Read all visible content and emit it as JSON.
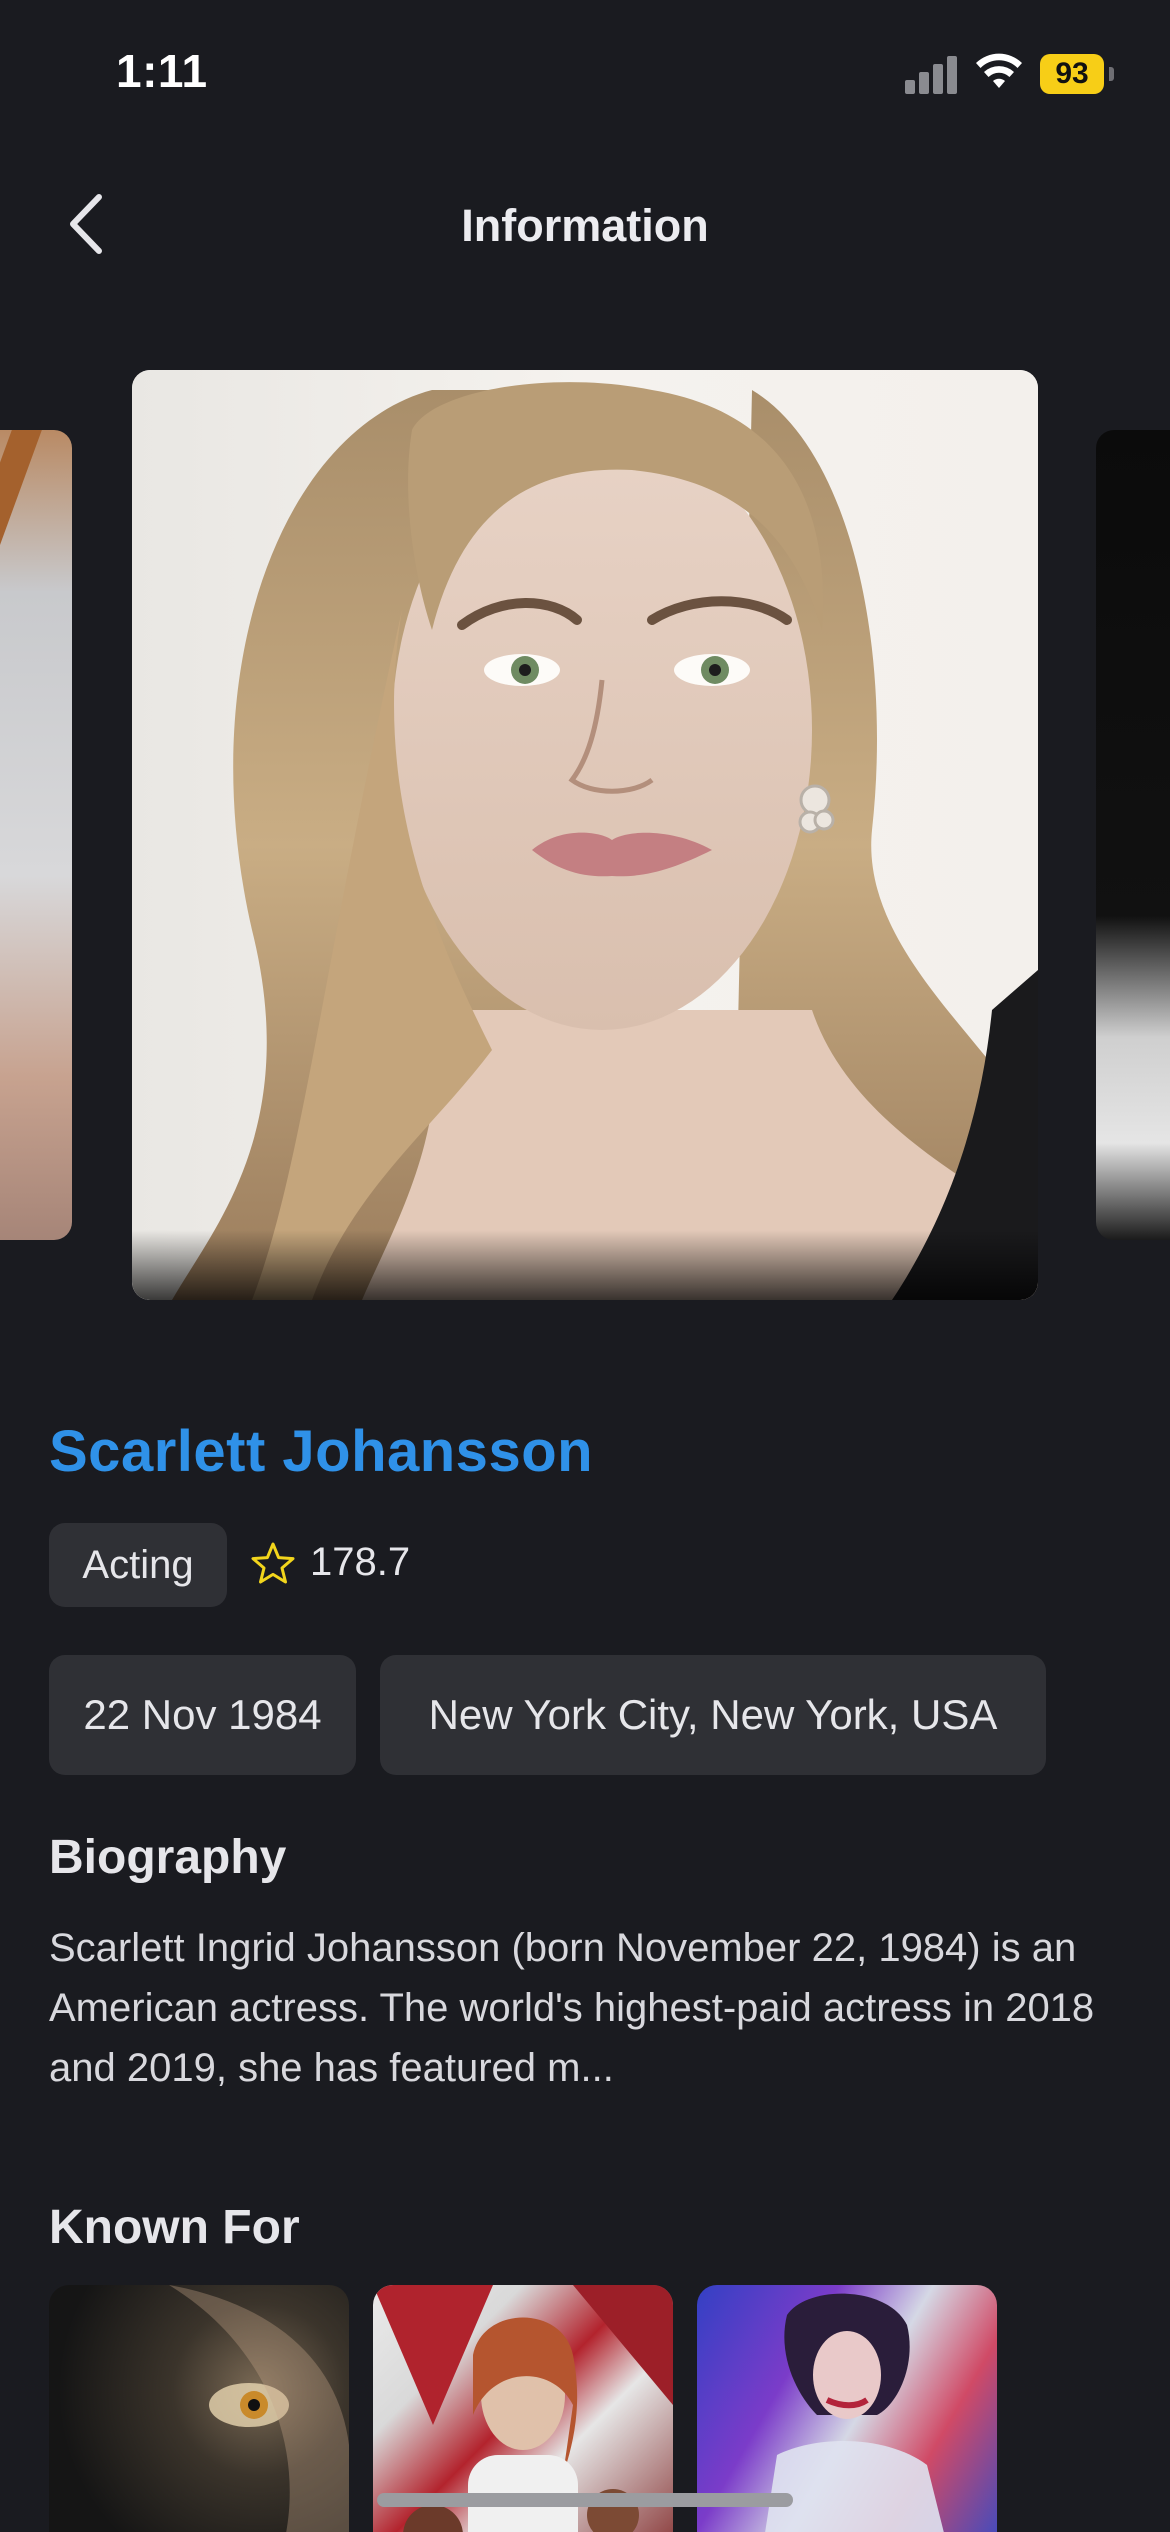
{
  "status_bar": {
    "time": "1:11",
    "battery": "93",
    "battery_color": "#f7ce17",
    "icons": [
      "cellular-signal-icon",
      "wifi-icon",
      "battery-icon"
    ]
  },
  "nav": {
    "title": "Information",
    "back_icon": "chevron-left-icon"
  },
  "person": {
    "name": "Scarlett Johansson",
    "name_color": "#2f91e8",
    "department": "Acting",
    "popularity_icon": "star-icon",
    "popularity": "178.7",
    "birthday": "22 Nov 1984",
    "place_of_birth": "New York City, New York, USA"
  },
  "biography": {
    "title": "Biography",
    "text": "Scarlett Ingrid Johansson (born November 22, 1984) is an American actress. The world's highest-paid actress in 2018 and 2019, she has featured m..."
  },
  "known_for": {
    "title": "Known For"
  }
}
